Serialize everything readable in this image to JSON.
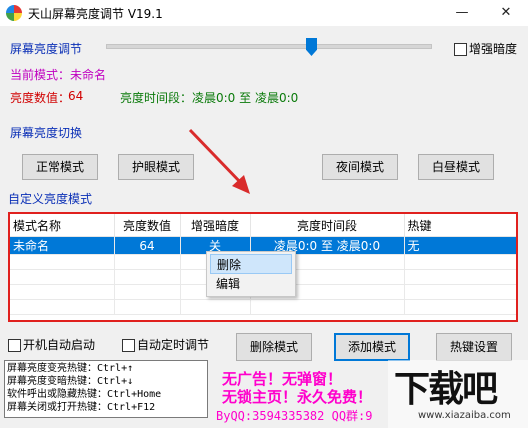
{
  "window": {
    "title": "天山屏幕亮度调节 V19.1",
    "minimize": "—",
    "close": "✕"
  },
  "brightness": {
    "label": "屏幕亮度调节",
    "level": 0.63,
    "enhance_label": "增强暗度"
  },
  "status": {
    "mode_label": "当前模式：未命名",
    "value_label": "亮度数值：",
    "value": "64",
    "period_label": "亮度时间段：凌晨0:0 至 凌晨0:0"
  },
  "switch": {
    "label": "屏幕亮度切换",
    "buttons": [
      "正常模式",
      "护眼模式",
      "夜间模式",
      "白昼模式"
    ]
  },
  "custom": {
    "label": "自定义亮度模式"
  },
  "table": {
    "headers": [
      "模式名称",
      "亮度数值",
      "增强暗度",
      "亮度时间段",
      "热键"
    ],
    "rows": [
      [
        "未命名",
        "64",
        "关",
        "凌晨0:0 至 凌晨0:0",
        "无"
      ]
    ]
  },
  "context_menu": [
    "删除",
    "编辑"
  ],
  "options": {
    "autostart": "开机自动启动",
    "auto_timer": "自动定时调节"
  },
  "actions": {
    "delete": "删除模式",
    "add": "添加模式",
    "hotkey": "热键设置"
  },
  "hotkeys": "屏幕亮度变亮热键：Ctrl+↑\n屏幕亮度变暗热键：Ctrl+↓\n软件呼出或隐藏热键：Ctrl+Home\n屏幕关闭或打开热键：Ctrl+F12",
  "promo": {
    "line1": "无广告！无弹窗！",
    "line2": "无锁主页！永久免费！",
    "qq": "ByQQ:3594335382 QQ群:9"
  },
  "watermark": {
    "logo": "下载吧",
    "url": "www.xiazaiba.com"
  },
  "colors": {
    "accent": "#0078d7",
    "highlight_border": "#e0201e",
    "arrow": "#d92b2b",
    "promo": "#ff00cc"
  }
}
